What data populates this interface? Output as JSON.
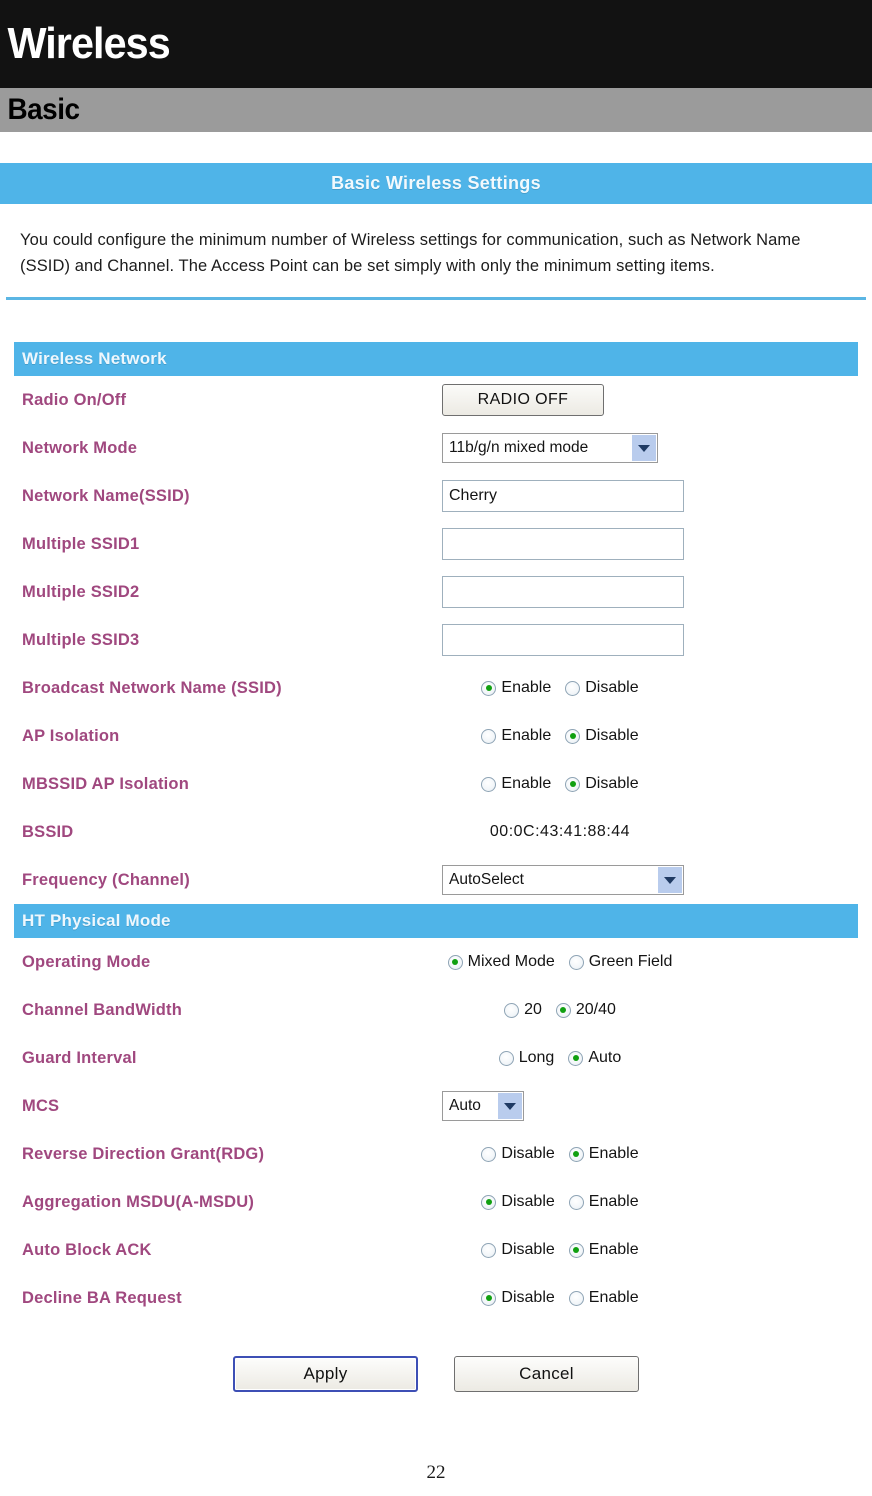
{
  "banner": {
    "title": "Wireless",
    "subtitle": "Basic"
  },
  "panel": {
    "title": "Basic Wireless Settings",
    "intro": "You could configure the minimum number of Wireless settings for communication, such as Network Name (SSID) and Channel. The Access Point can be set simply with only the minimum setting items."
  },
  "sections": [
    {
      "header": "Wireless Network",
      "rows": [
        {
          "label": "Radio On/Off",
          "type": "button",
          "value": "RADIO OFF"
        },
        {
          "label": "Network Mode",
          "type": "select",
          "value": "11b/g/n mixed mode"
        },
        {
          "label": "Network Name(SSID)",
          "type": "text",
          "value": "Cherry",
          "placeholder": ""
        },
        {
          "label": "Multiple SSID1",
          "type": "text",
          "value": "",
          "placeholder": ""
        },
        {
          "label": "Multiple SSID2",
          "type": "text",
          "value": "",
          "placeholder": ""
        },
        {
          "label": "Multiple SSID3",
          "type": "text",
          "value": "",
          "placeholder": ""
        },
        {
          "label": "Broadcast Network Name (SSID)",
          "type": "radios",
          "options": [
            "Enable",
            "Disable"
          ],
          "selected": 0
        },
        {
          "label": "AP Isolation",
          "type": "radios",
          "options": [
            "Enable",
            "Disable"
          ],
          "selected": 1
        },
        {
          "label": "MBSSID AP Isolation",
          "type": "radios",
          "options": [
            "Enable",
            "Disable"
          ],
          "selected": 1
        },
        {
          "label": "BSSID",
          "type": "static",
          "value": "00:0C:43:41:88:44"
        },
        {
          "label": "Frequency (Channel)",
          "type": "select",
          "value": "AutoSelect"
        }
      ]
    },
    {
      "header": "HT Physical Mode",
      "rows": [
        {
          "label": "Operating Mode",
          "type": "radios",
          "options": [
            "Mixed Mode",
            "Green Field"
          ],
          "selected": 0
        },
        {
          "label": "Channel BandWidth",
          "type": "radios",
          "options": [
            "20",
            "20/40"
          ],
          "selected": 1
        },
        {
          "label": "Guard Interval",
          "type": "radios",
          "options": [
            "Long",
            "Auto"
          ],
          "selected": 1
        },
        {
          "label": "MCS",
          "type": "select",
          "value": "Auto"
        },
        {
          "label": "Reverse Direction Grant(RDG)",
          "type": "radios",
          "options": [
            "Disable",
            "Enable"
          ],
          "selected": 1
        },
        {
          "label": "Aggregation MSDU(A-MSDU)",
          "type": "radios",
          "options": [
            "Disable",
            "Enable"
          ],
          "selected": 0
        },
        {
          "label": "Auto Block ACK",
          "type": "radios",
          "options": [
            "Disable",
            "Enable"
          ],
          "selected": 1
        },
        {
          "label": "Decline BA Request",
          "type": "radios",
          "options": [
            "Disable",
            "Enable"
          ],
          "selected": 0
        }
      ]
    }
  ],
  "actions": {
    "apply": "Apply",
    "cancel": "Cancel"
  },
  "footer": {
    "page_number": "22"
  },
  "colors": {
    "accent_blue": "#4fb4e8",
    "label_purple": "#a0487f",
    "banner_black": "#121212",
    "subbanner_gray": "#9b9b9b",
    "radio_dot_green": "#11a011"
  }
}
